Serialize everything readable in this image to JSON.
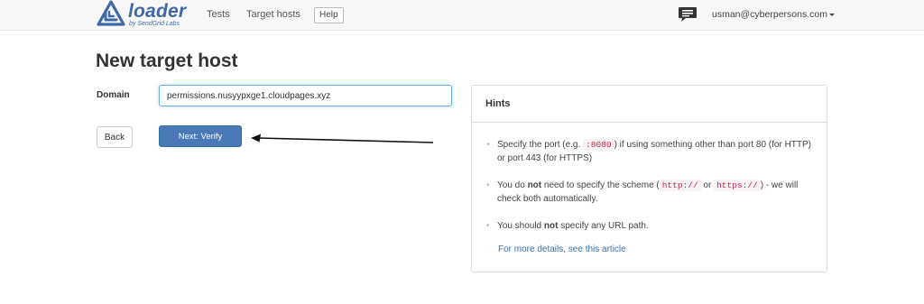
{
  "brand": {
    "name": "loader",
    "subtitle": "by SendGrid Labs",
    "color": "#3f6aa8"
  },
  "nav": {
    "tests": "Tests",
    "target_hosts": "Target hosts",
    "help": "Help",
    "chat_icon": "chat-bubble-icon",
    "user_email": "usman@cyberpersons.com"
  },
  "page": {
    "title": "New target host"
  },
  "form": {
    "domain_label": "Domain",
    "domain_value": "permissions.nusyypxge1.cloudpages.xyz",
    "back_label": "Back",
    "next_label": "Next: Verify"
  },
  "hints": {
    "heading": "Hints",
    "port": {
      "pre": "Specify the port (e.g. ",
      "code": ":8080",
      "post": ") if using something other than port 80 (for HTTP) or port 443 (for HTTPS)"
    },
    "scheme": {
      "pre": "You do ",
      "bold": "not",
      "mid": " need to specify the scheme (",
      "code1": "http://",
      "or": " or ",
      "code2": "https://",
      "post": ") - we will check both automatically."
    },
    "path": {
      "pre": "You should ",
      "bold": "not",
      "post": " specify any URL path."
    },
    "details_link": "For more details, see this article"
  },
  "colors": {
    "primary_button": "#4a79b8",
    "link": "#3a6fb0",
    "code_text": "#c7254e"
  }
}
